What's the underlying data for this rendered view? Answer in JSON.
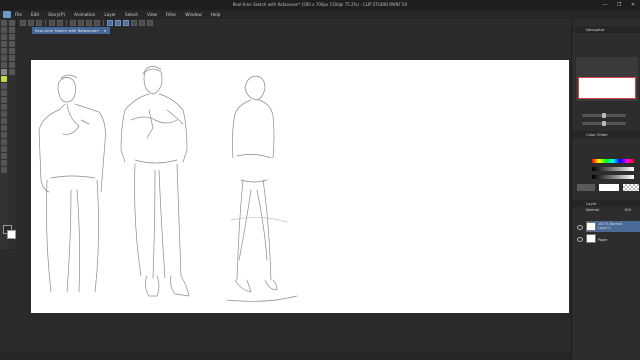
{
  "window": {
    "title": "Real-time Sketch with Rafasevan* (500 x 700px 150dpi 75.2%) - CLIP STUDIO PAINT EX",
    "controls": [
      "—",
      "❐",
      "✕"
    ]
  },
  "menu": [
    "File",
    "Edit",
    "Story(P)",
    "Animation",
    "Layer",
    "Select",
    "View",
    "Filter",
    "Window",
    "Help"
  ],
  "document_tab": {
    "label": "Real-time Sketch with Rafasevan*",
    "close": "×"
  },
  "navigator": {
    "title": "Navigator"
  },
  "color_panel": {
    "title": "Color Slider"
  },
  "layer_panel": {
    "title": "Layer",
    "blend_mode": "Normal",
    "opacity": "100",
    "layers": [
      {
        "name": "100 % Normal",
        "sub": "Layer 2",
        "selected": true
      },
      {
        "name": "Paper",
        "sub": "",
        "selected": false
      }
    ]
  },
  "toolbox_colors": {
    "main": "#2a2a2a",
    "sub": "#ffffff"
  },
  "accent": "#44689a"
}
